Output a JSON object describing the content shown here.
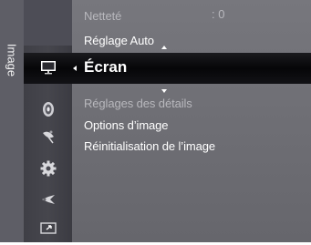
{
  "tab": {
    "label": "Image"
  },
  "menu": {
    "items": [
      {
        "label": "Netteté",
        "value": ": 0",
        "state": "dimmed"
      },
      {
        "label": "Réglage Auto",
        "state": "normal"
      },
      {
        "label": "Écran",
        "state": "selected"
      },
      {
        "label": "Réglages des détails",
        "state": "dimmed"
      },
      {
        "label": "Options d’image",
        "state": "normal"
      },
      {
        "label": "Réinitialisation de l’image",
        "state": "normal"
      }
    ]
  },
  "icons": [
    {
      "name": "monitor-icon"
    },
    {
      "name": "speaker-icon"
    },
    {
      "name": "satellite-icon"
    },
    {
      "name": "gear-icon"
    },
    {
      "name": "plug-icon"
    },
    {
      "name": "input-icon"
    }
  ],
  "colors": {
    "panel": "#6a6a70",
    "selected_bar": "#0a0a0c",
    "text": "#ffffff",
    "dim_text": "#b8b8bd"
  }
}
